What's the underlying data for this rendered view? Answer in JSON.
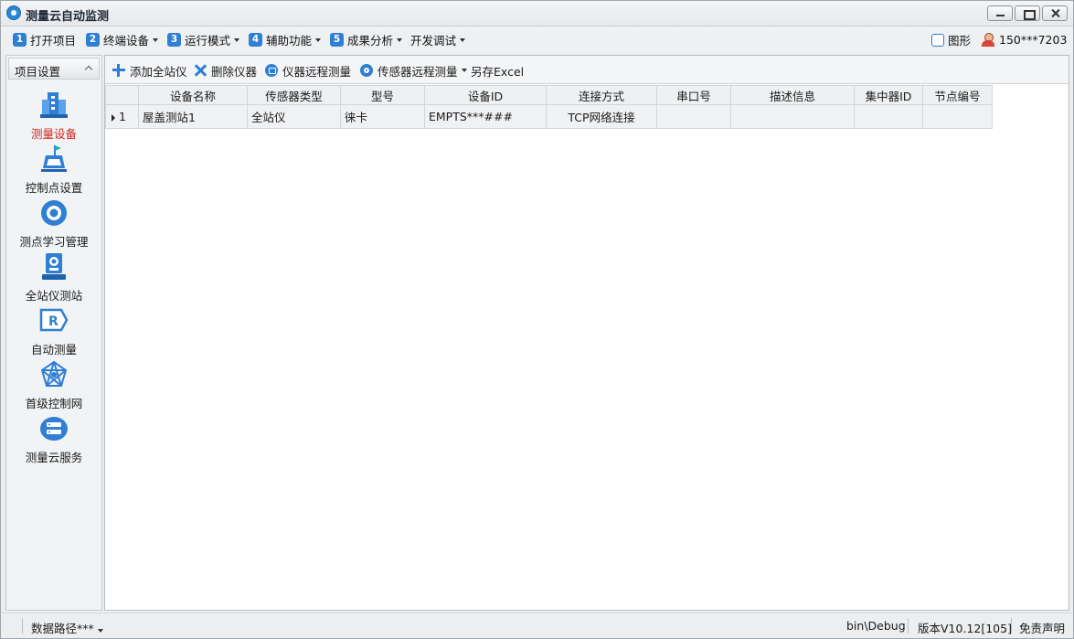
{
  "window": {
    "title": "测量云自动监测"
  },
  "menu": {
    "items": [
      {
        "num": "1",
        "label": "打开项目"
      },
      {
        "num": "2",
        "label": "终端设备"
      },
      {
        "num": "3",
        "label": "运行模式"
      },
      {
        "num": "4",
        "label": "辅助功能"
      },
      {
        "num": "5",
        "label": "成果分析"
      },
      {
        "num": "",
        "label": "开发调试"
      }
    ],
    "chart_toggle_label": "图形",
    "user_label": "150***7203"
  },
  "sidebar": {
    "header": "项目设置",
    "items": [
      {
        "label": "测量设备",
        "icon": "building-icon",
        "active": true
      },
      {
        "label": "控制点设置",
        "icon": "control-point-icon"
      },
      {
        "label": "测点学习管理",
        "icon": "target-icon"
      },
      {
        "label": "全站仪测站",
        "icon": "total-station-icon"
      },
      {
        "label": "自动测量",
        "icon": "auto-measure-icon"
      },
      {
        "label": "首级控制网",
        "icon": "network-icon"
      },
      {
        "label": "测量云服务",
        "icon": "cloud-service-icon"
      }
    ]
  },
  "toolbar": {
    "add_label": "添加全站仪",
    "delete_label": "删除仪器",
    "remote_label": "仪器远程测量",
    "sensor_label": "传感器远程测量",
    "export_label": "另存Excel"
  },
  "table": {
    "columns": [
      "",
      "设备名称",
      "传感器类型",
      "型号",
      "设备ID",
      "连接方式",
      "串口号",
      "描述信息",
      "集中器ID",
      "节点编号"
    ],
    "rows": [
      {
        "index": "1",
        "name": "屋盖测站1",
        "sensor_type": "全站仪",
        "model": "徕卡",
        "device_id": "EMPTS***###",
        "connection": "TCP网络连接",
        "serial_port": "",
        "description": "",
        "concentrator_id": "",
        "node_no": ""
      }
    ]
  },
  "status": {
    "data_path": "数据路径***",
    "bin_path": "bin\\Debug",
    "version": "版本V10.12[105]",
    "disclaimer": "免责声明"
  },
  "colors": {
    "accent": "#2f7fd4",
    "active_nav": "#d0241c"
  }
}
